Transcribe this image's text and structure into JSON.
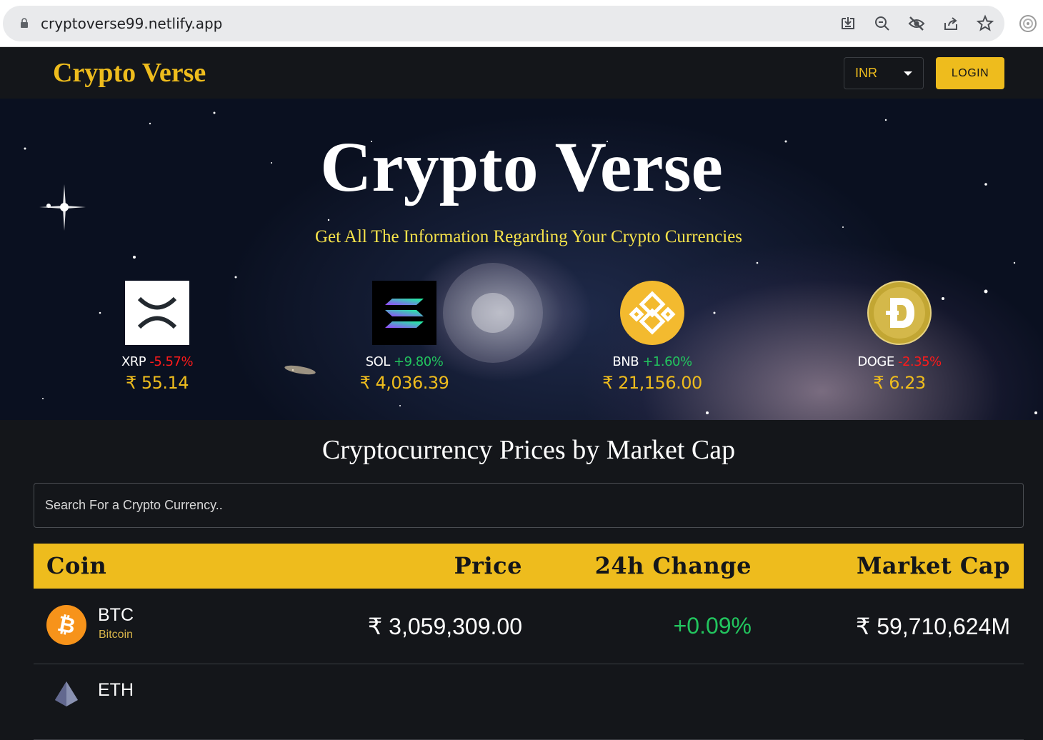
{
  "browser": {
    "url": "cryptoverse99.netlify.app",
    "icons": [
      "lock-icon",
      "install-icon",
      "zoom-out-icon",
      "tracking-off-icon",
      "share-icon",
      "bookmark-star-icon",
      "extension-icon"
    ]
  },
  "header": {
    "brand": "Crypto Verse",
    "currency": "INR",
    "login_label": "LOGIN"
  },
  "hero": {
    "title": "Crypto Verse",
    "subtitle": "Get All The Information Regarding Your Crypto Currencies",
    "trending": [
      {
        "symbol": "XRP",
        "change": "-5.57%",
        "price": "₹ 55.14"
      },
      {
        "symbol": "SOL",
        "change": "+9.80%",
        "price": "₹ 4,036.39"
      },
      {
        "symbol": "BNB",
        "change": "+1.60%",
        "price": "₹ 21,156.00"
      },
      {
        "symbol": "DOGE",
        "change": "-2.35%",
        "price": "₹ 6.23"
      }
    ]
  },
  "market": {
    "title": "Cryptocurrency Prices by Market Cap",
    "search_placeholder": "Search For a Crypto Currency..",
    "columns": [
      "Coin",
      "Price",
      "24h Change",
      "Market Cap"
    ],
    "rows": [
      {
        "symbol": "BTC",
        "name": "Bitcoin",
        "price": "₹ 3,059,309.00",
        "change": "+0.09%",
        "market_cap": "₹ 59,710,624M"
      },
      {
        "symbol": "ETH",
        "name": "",
        "price": "",
        "change": "",
        "market_cap": ""
      }
    ]
  },
  "colors": {
    "accent": "#eebc1d",
    "background": "#14161a",
    "positive": "#22c55e",
    "negative": "#ff1a1a"
  }
}
